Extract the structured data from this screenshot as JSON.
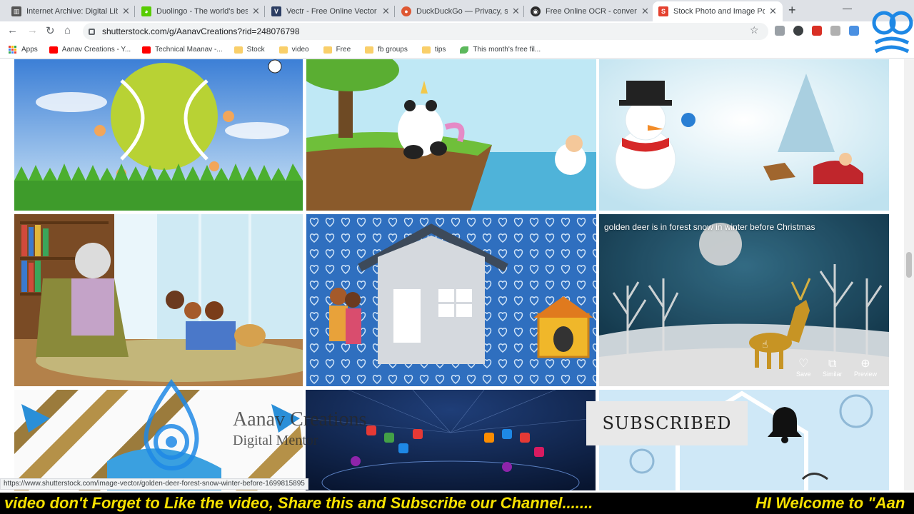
{
  "tabs": [
    {
      "title": "Internet Archive: Digital Libra",
      "fav_color": "#555555",
      "fav_glyph": "▥"
    },
    {
      "title": "Duolingo - The world's best",
      "fav_color": "#58cc02",
      "fav_glyph": "◕"
    },
    {
      "title": "Vectr - Free Online Vector Gr",
      "fav_color": "#2c3e63",
      "fav_glyph": "V"
    },
    {
      "title": "DuckDuckGo — Privacy, simp",
      "fav_color": "#de5833",
      "fav_glyph": "●"
    },
    {
      "title": "Free Online OCR - convert PD",
      "fav_color": "#2b2b2b",
      "fav_glyph": "◉"
    },
    {
      "title": "Stock Photo and Image Portf",
      "fav_color": "#e4412f",
      "fav_glyph": "S"
    }
  ],
  "address_bar": {
    "url": "shutterstock.com/g/AanavCreations?rid=248076798"
  },
  "bookmarks": {
    "apps": "Apps",
    "items": [
      {
        "label": "Aanav Creations - Y...",
        "icon": "youtube-icon"
      },
      {
        "label": "Technical Maanav -...",
        "icon": "youtube-icon"
      },
      {
        "label": "Stock",
        "icon": "folder-icon"
      },
      {
        "label": "video",
        "icon": "folder-icon"
      },
      {
        "label": "Free",
        "icon": "folder-icon"
      },
      {
        "label": "fb groups",
        "icon": "folder-icon"
      },
      {
        "label": "tips",
        "icon": "folder-icon"
      },
      {
        "label": "This month's free fil...",
        "icon": "leaf-icon"
      }
    ]
  },
  "hover_tile": {
    "caption": "golden deer is in forest snow in winter before Christmas",
    "actions": [
      {
        "label": "Save",
        "icon": "heart-icon"
      },
      {
        "label": "Similar",
        "icon": "stack-icon"
      },
      {
        "label": "Preview",
        "icon": "zoom-icon"
      }
    ]
  },
  "status_url": "https://www.shutterstock.com/image-vector/golden-deer-forest-snow-winter-before-1699815895",
  "overlay": {
    "subscribed": "SUBSCRIBED",
    "brand_name": "Aanav Creations",
    "brand_tagline": "Digital Mentor"
  },
  "ticker": {
    "left": "video don't Forget to Like the video, Share this and Subscribe our Channel.......",
    "right": "HI Welcome to \"Aan"
  },
  "colors": {
    "accent": "#1a73e8",
    "ticker_text": "#f5e000",
    "tab_active": "#ffffff"
  }
}
